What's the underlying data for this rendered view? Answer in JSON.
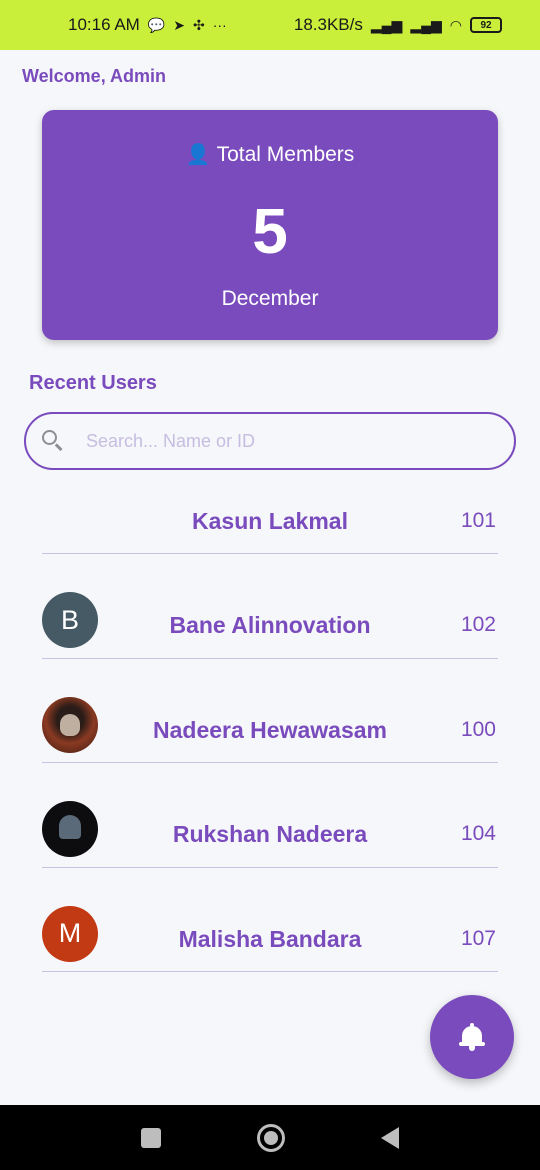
{
  "status_bar": {
    "time": "10:16 AM",
    "more": "···",
    "network_speed": "18.3KB/s",
    "battery": "92"
  },
  "welcome": "Welcome, Admin",
  "members_card": {
    "title": "Total Members",
    "count": "5",
    "month": "December",
    "icon": "person-icon"
  },
  "recent_users": {
    "title": "Recent Users",
    "search_placeholder": "Search... Name or ID",
    "users": [
      {
        "name": "Kasun Lakmal",
        "id": "101",
        "avatar": "none"
      },
      {
        "name": "Bane Alinnovation",
        "id": "102",
        "avatar": "letter",
        "initial": "B",
        "color": "#455a64"
      },
      {
        "name": "Nadeera Hewawasam",
        "id": "100",
        "avatar": "photo"
      },
      {
        "name": "Rukshan Nadeera",
        "id": "104",
        "avatar": "photo"
      },
      {
        "name": "Malisha Bandara",
        "id": "107",
        "avatar": "letter",
        "initial": "M",
        "color": "#c23a14"
      }
    ]
  },
  "fab": {
    "icon": "bell-icon"
  },
  "colors": {
    "accent": "#7a4bbd",
    "status_bar": "#c9ef3a",
    "background": "#f6f7fa"
  }
}
